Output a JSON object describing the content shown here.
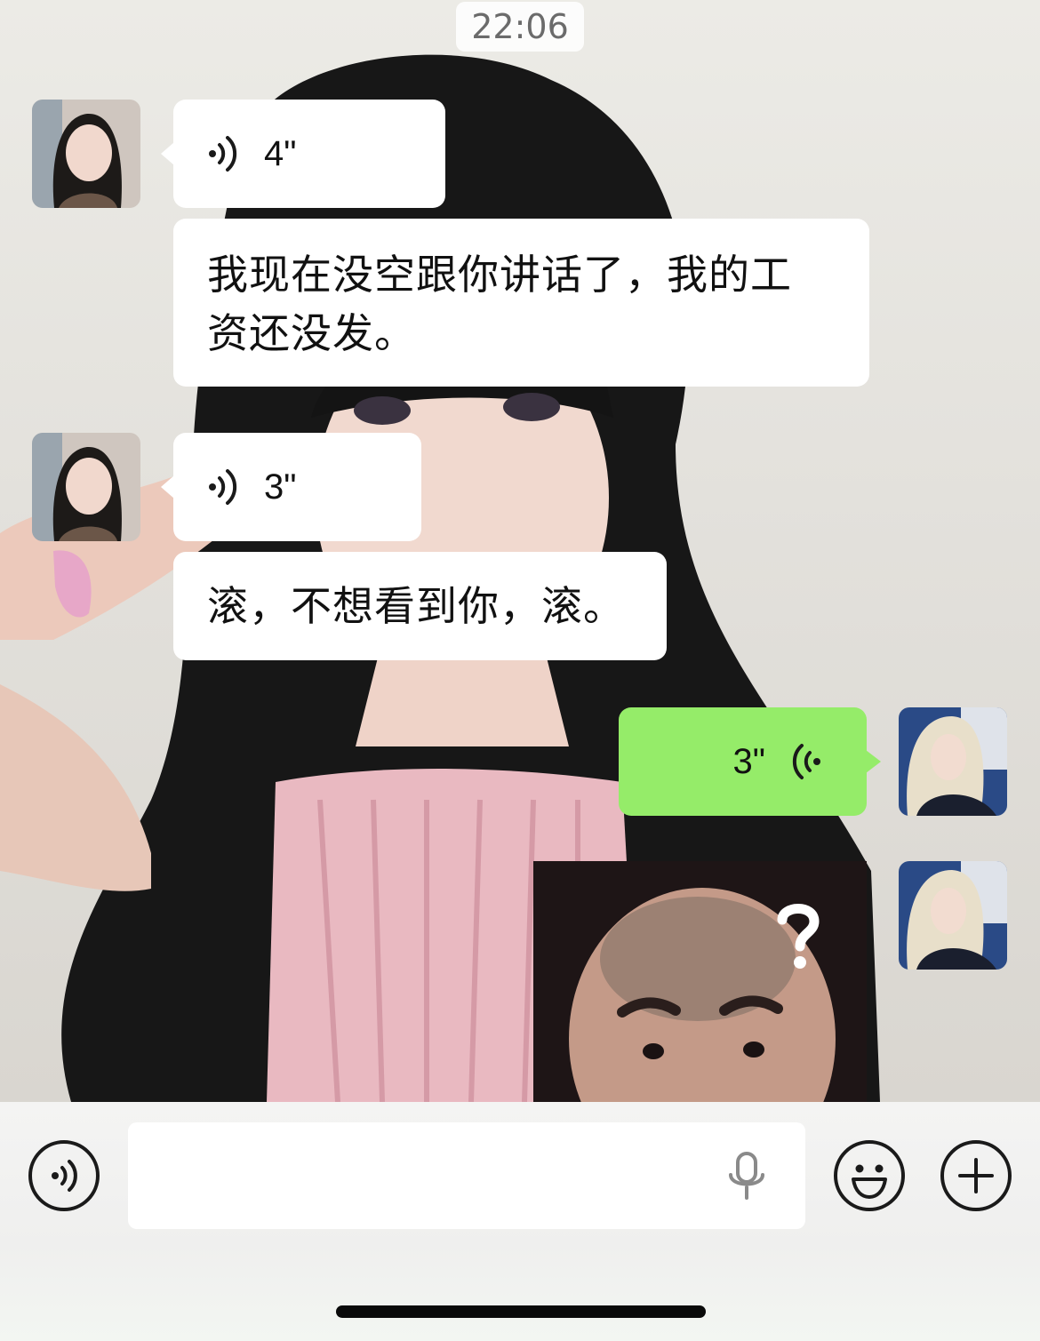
{
  "chat": {
    "timestamp": "22:06",
    "messages": [
      {
        "sender": "contact",
        "type": "voice",
        "duration": "4\""
      },
      {
        "sender": "contact",
        "type": "text",
        "lines": [
          "我现在没空跟你讲话了，我的工",
          "资还没发。"
        ]
      },
      {
        "sender": "contact",
        "type": "voice",
        "duration": "3\""
      },
      {
        "sender": "contact",
        "type": "text",
        "lines": [
          "滚，不想看到你，滚。"
        ]
      },
      {
        "sender": "me",
        "type": "voice",
        "duration": "3\""
      },
      {
        "sender": "me",
        "type": "sticker",
        "icon": "question-mark"
      }
    ]
  },
  "input_bar": {
    "voice_toggle_icon": "voice-wave-icon",
    "text_value": "",
    "mic_icon": "microphone-icon",
    "emoji_icon": "smiley-icon",
    "more_icon": "plus-icon"
  },
  "colors": {
    "my_bubble": "#95ec69",
    "their_bubble": "#ffffff",
    "timestamp_text": "#6b6b6b"
  }
}
